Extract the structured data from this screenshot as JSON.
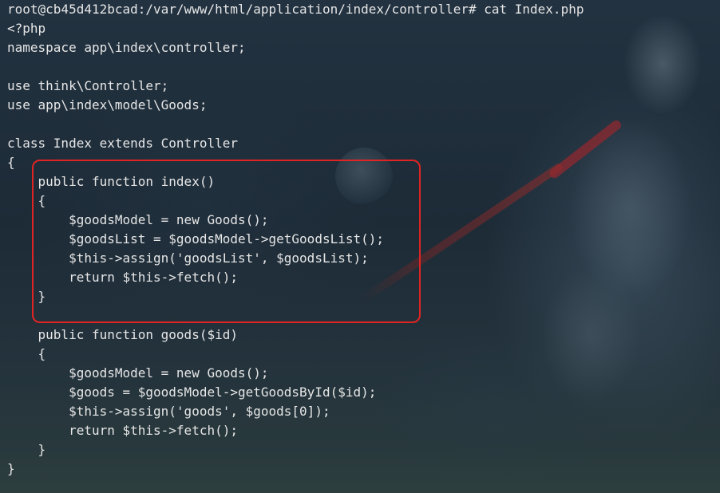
{
  "terminal": {
    "prompt_line": "root@cb45d412bcad:/var/www/html/application/index/controller# cat Index.php",
    "lines": [
      "<?php",
      "namespace app\\index\\controller;",
      "",
      "use think\\Controller;",
      "use app\\index\\model\\Goods;",
      "",
      "class Index extends Controller",
      "{",
      "    public function index()",
      "    {",
      "        $goodsModel = new Goods();",
      "        $goodsList = $goodsModel->getGoodsList();",
      "        $this->assign('goodsList', $goodsList);",
      "        return $this->fetch();",
      "    }",
      "",
      "    public function goods($id)",
      "    {",
      "        $goodsModel = new Goods();",
      "        $goods = $goodsModel->getGoodsById($id);",
      "        $this->assign('goods', $goods[0]);",
      "        return $this->fetch();",
      "    }",
      "}"
    ]
  },
  "highlight": {
    "color": "#e02424"
  },
  "colors": {
    "text": "#e6e6e6",
    "background": "#1c2a36"
  }
}
